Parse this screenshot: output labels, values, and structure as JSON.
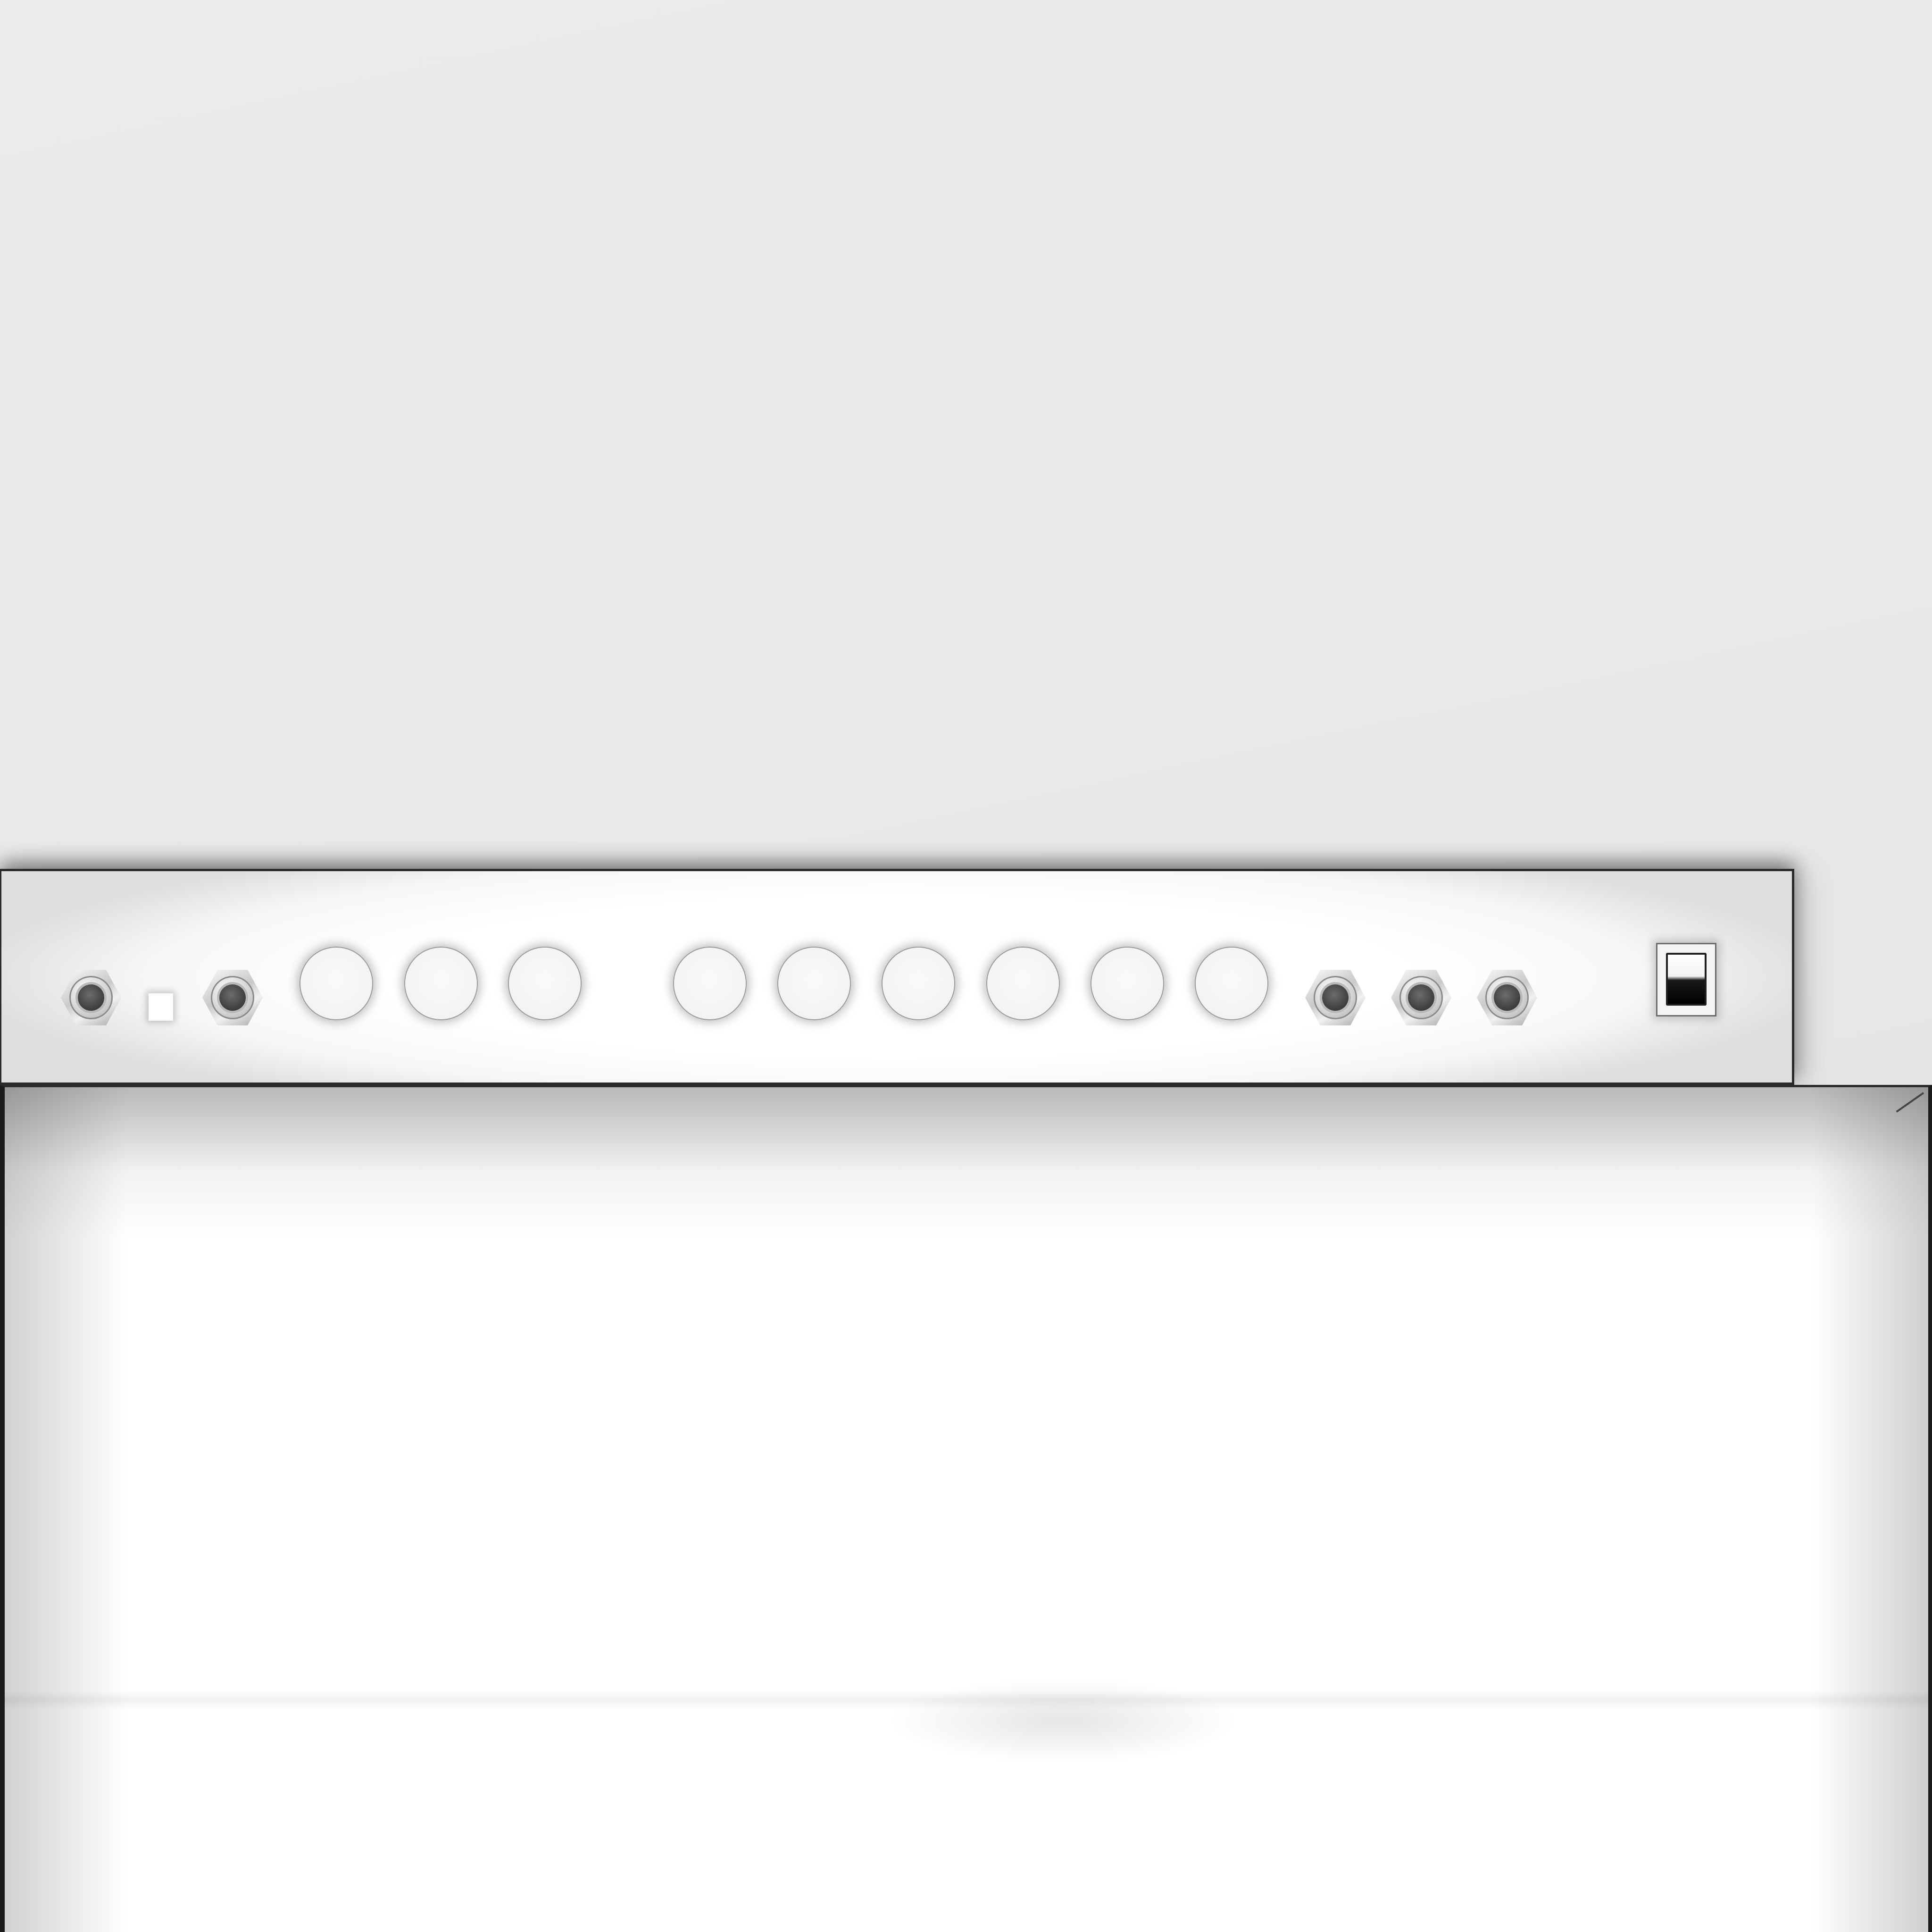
{
  "scene": {
    "description_free": true
  },
  "panel": {
    "controls": [
      {
        "kind": "jack",
        "name": "input-jack-1"
      },
      {
        "kind": "led",
        "name": "indicator-light"
      },
      {
        "kind": "jack",
        "name": "input-jack-2"
      },
      {
        "kind": "knob",
        "name": "knob-1"
      },
      {
        "kind": "knob",
        "name": "knob-2"
      },
      {
        "kind": "knob",
        "name": "knob-3"
      },
      {
        "kind": "knob",
        "name": "knob-4"
      },
      {
        "kind": "knob",
        "name": "knob-5"
      },
      {
        "kind": "knob",
        "name": "knob-6"
      },
      {
        "kind": "knob",
        "name": "knob-7"
      },
      {
        "kind": "knob",
        "name": "knob-8"
      },
      {
        "kind": "knob",
        "name": "knob-9"
      },
      {
        "kind": "jack",
        "name": "output-jack-1"
      },
      {
        "kind": "jack",
        "name": "output-jack-2"
      },
      {
        "kind": "jack",
        "name": "output-jack-3"
      },
      {
        "kind": "switch",
        "name": "power-switch",
        "state": "on"
      }
    ]
  }
}
